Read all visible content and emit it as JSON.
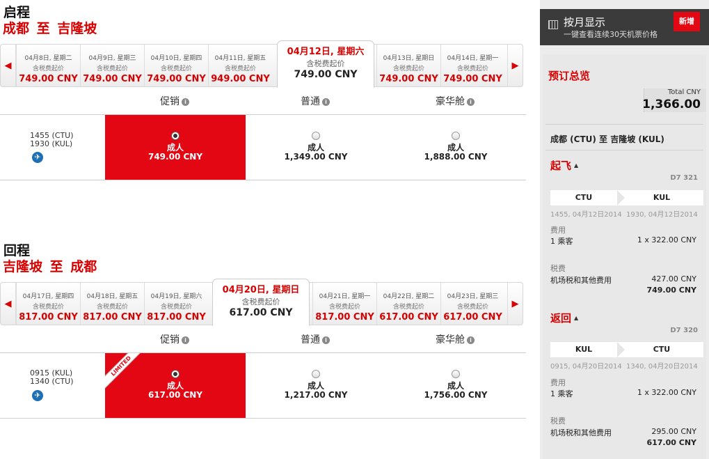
{
  "outbound": {
    "title": "启程",
    "route": "成都 至 吉隆坡",
    "dates": [
      {
        "date": "04月8日, 星期二",
        "label": "含税费起价",
        "price": "749.00 CNY"
      },
      {
        "date": "04月9日, 星期三",
        "label": "含税费起价",
        "price": "749.00 CNY"
      },
      {
        "date": "04月10日, 星期四",
        "label": "含税费起价",
        "price": "749.00 CNY"
      },
      {
        "date": "04月11日, 星期五",
        "label": "含税费起价",
        "price": "949.00 CNY"
      },
      {
        "date": "04月12日, 星期六",
        "label": "含税费起价",
        "price": "749.00 CNY"
      },
      {
        "date": "04月13日, 星期日",
        "label": "含税费起价",
        "price": "749.00 CNY"
      },
      {
        "date": "04月14日, 星期一",
        "label": "含税费起价",
        "price": "749.00 CNY"
      }
    ],
    "fare_headers": [
      "促销",
      "普通",
      "豪华舱"
    ],
    "flight": {
      "depart": "1455 (CTU)",
      "arrive": "1930 (KUL)"
    },
    "fares": [
      {
        "label": "成人",
        "price": "749.00 CNY"
      },
      {
        "label": "成人",
        "price": "1,349.00 CNY"
      },
      {
        "label": "成人",
        "price": "1,888.00 CNY"
      }
    ]
  },
  "return": {
    "title": "回程",
    "route": "吉隆坡 至 成都",
    "dates": [
      {
        "date": "04月17日, 星期四",
        "label": "含税费起价",
        "price": "817.00 CNY"
      },
      {
        "date": "04月18日, 星期五",
        "label": "含税费起价",
        "price": "817.00 CNY"
      },
      {
        "date": "04月19日, 星期六",
        "label": "含税费起价",
        "price": "817.00 CNY"
      },
      {
        "date": "04月20日, 星期日",
        "label": "含税费起价",
        "price": "617.00 CNY"
      },
      {
        "date": "04月21日, 星期一",
        "label": "含税费起价",
        "price": "817.00 CNY"
      },
      {
        "date": "04月22日, 星期二",
        "label": "含税费起价",
        "price": "617.00 CNY"
      },
      {
        "date": "04月23日, 星期三",
        "label": "含税费起价",
        "price": "617.00 CNY"
      }
    ],
    "fare_headers": [
      "促销",
      "普通",
      "豪华舱"
    ],
    "flight": {
      "depart": "0915 (KUL)",
      "arrive": "1340 (CTU)"
    },
    "limited_badge": "LIMITED",
    "fares": [
      {
        "label": "成人",
        "price": "617.00 CNY"
      },
      {
        "label": "成人",
        "price": "1,217.00 CNY"
      },
      {
        "label": "成人",
        "price": "1,756.00 CNY"
      }
    ]
  },
  "sidebar": {
    "monthly_title": "按月显示",
    "monthly_sub": "一键查看连续30天机票价格",
    "new_badge": "新增",
    "summary_title": "预订总览",
    "total_label": "Total CNY",
    "total_value": "1,366.00",
    "route_line": "成都 (CTU) 至 吉隆坡 (KUL)",
    "depart_section": {
      "title": "起飞",
      "flight_no": "D7 321",
      "from": "CTU",
      "to": "KUL",
      "from_time": "1455, 04月12日2014",
      "to_time": "1930, 04月12日2014",
      "fee_label": "费用",
      "pax": "1 乘客",
      "pax_amount": "1 x 322.00 CNY",
      "tax_label": "税费",
      "tax_name": "机场税和其他费用",
      "tax_amount": "427.00 CNY",
      "subtotal": "749.00 CNY"
    },
    "return_section": {
      "title": "返回",
      "flight_no": "D7 320",
      "from": "KUL",
      "to": "CTU",
      "from_time": "0915, 04月20日2014",
      "to_time": "1340, 04月20日2014",
      "fee_label": "费用",
      "pax": "1 乘客",
      "pax_amount": "1 x 322.00 CNY",
      "tax_label": "税费",
      "tax_name": "机场税和其他费用",
      "tax_amount": "295.00 CNY",
      "subtotal": "617.00 CNY"
    }
  }
}
